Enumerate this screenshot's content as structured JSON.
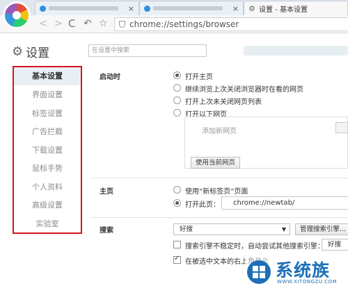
{
  "tabs": [
    {
      "label": "",
      "active": false
    },
    {
      "label": "",
      "active": false
    },
    {
      "label": "设置 - 基本设置",
      "active": true
    }
  ],
  "toolbar": {
    "back_icon": "back-arrow-icon",
    "forward_icon": "forward-arrow-icon",
    "reload_icon": "reload-icon",
    "undo_icon": "undo-icon",
    "star_icon": "star-icon",
    "url": "chrome://settings/browser"
  },
  "settings": {
    "title": "设置",
    "search_placeholder": "在设置中搜索"
  },
  "sidebar": {
    "items": [
      {
        "label": "基本设置",
        "active": true
      },
      {
        "label": "界面设置",
        "active": false
      },
      {
        "label": "标签设置",
        "active": false
      },
      {
        "label": "广告拦截",
        "active": false
      },
      {
        "label": "下载设置",
        "active": false
      },
      {
        "label": "鼠标手势",
        "active": false
      },
      {
        "label": "个人资料",
        "active": false
      },
      {
        "label": "高级设置",
        "active": false
      },
      {
        "label": "实验室",
        "active": false
      }
    ]
  },
  "startup": {
    "label": "启动时",
    "options": [
      {
        "label": "打开主页",
        "checked": true
      },
      {
        "label": "继续浏览上次关闭浏览器时在看的网页",
        "checked": false
      },
      {
        "label": "打开上次未关闭网页列表",
        "checked": false
      },
      {
        "label": "打开以下网页",
        "checked": false
      }
    ],
    "add_page_placeholder": "添加新网页",
    "use_current_button": "使用当前网页"
  },
  "homepage": {
    "label": "主页",
    "option_new_tab": "使用“新标签页”页面",
    "option_open_page": "打开此页：",
    "new_tab_checked": false,
    "open_page_checked": true,
    "url_value": "chrome://newtab/"
  },
  "search": {
    "label": "搜索",
    "engine_selected": "好搜",
    "manage_button": "管理搜索引擎...",
    "fallback_label": "搜索引擎不稳定时，自动尝试其他搜索引擎：",
    "fallback_checked": false,
    "fallback_selected": "好搜",
    "selected_text_label": "在被选中文本的右上角显示",
    "selected_text_checked": true
  },
  "watermark": {
    "title": "系统族",
    "subtitle": "WWW.XITONGZU.COM"
  },
  "colors": {
    "sidebar_highlight_border": "#d0161c",
    "watermark_blue": "#1c6fb8"
  }
}
